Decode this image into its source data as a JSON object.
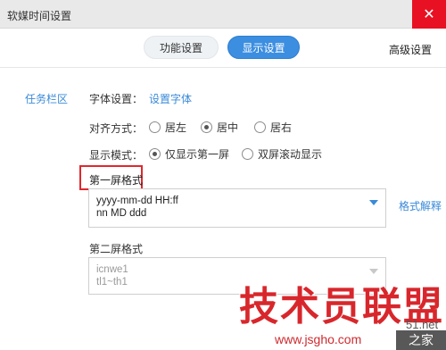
{
  "window": {
    "title": "软媒时间设置",
    "close_label": "✕"
  },
  "tabs": {
    "functional": "功能设置",
    "display": "显示设置",
    "advanced": "高级设置"
  },
  "sidebar": {
    "items": [
      {
        "label": "任务栏区"
      }
    ]
  },
  "font": {
    "label": "字体设置：",
    "link": "设置字体"
  },
  "align": {
    "label": "对齐方式：",
    "options": [
      "居左",
      "居中",
      "居右"
    ],
    "selected": "居中"
  },
  "mode": {
    "label": "显示模式：",
    "options": [
      "仅显示第一屏",
      "双屏滚动显示"
    ],
    "selected": "仅显示第一屏"
  },
  "screen1": {
    "label": "第一屏格式",
    "lines": [
      "yyyy-mm-dd HH:ff",
      "nn MD ddd"
    ],
    "help_link": "格式解释"
  },
  "screen2": {
    "label": "第二屏格式",
    "lines": [
      "icnwe1",
      "tl1~th1"
    ]
  },
  "watermark": {
    "text": "技术员联盟",
    "url": "www.jsgho.com",
    "net": "51.net",
    "corner": "之家"
  },
  "colors": {
    "accent": "#3c8ee0",
    "link": "#3a8ad8",
    "close": "#e81123",
    "highlight": "#e0282e"
  }
}
